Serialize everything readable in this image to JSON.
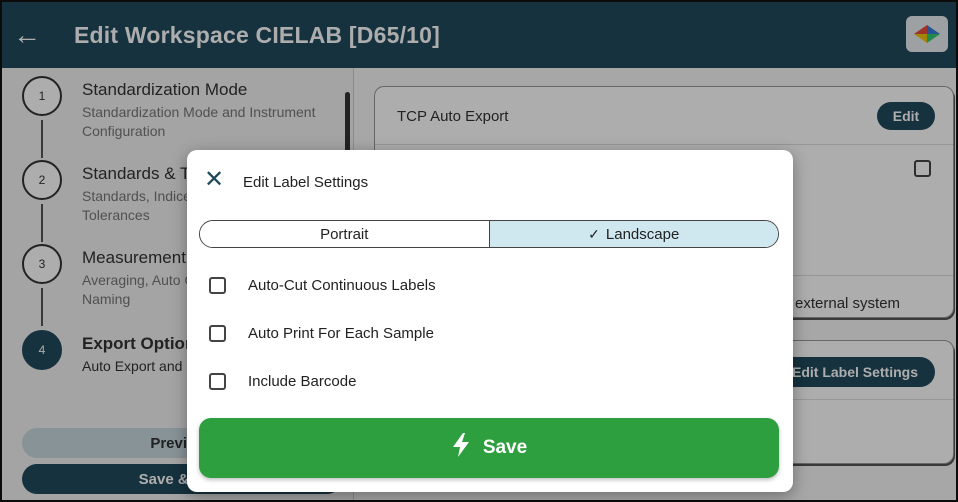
{
  "header": {
    "back_icon": "arrow-left-icon",
    "title": "Edit Workspace CIELAB [D65/10]",
    "logo_icon": "color-diamond-icon"
  },
  "steps": [
    {
      "number": "1",
      "title": "Standardization Mode",
      "desc": "Standardization Mode and Instrument Configuration"
    },
    {
      "number": "2",
      "title": "Standards & Tolerances",
      "desc": "Standards, Indices, Illuminants and Tolerances"
    },
    {
      "number": "3",
      "title": "Measurement",
      "desc": "Averaging, Auto Capture and Sample Naming"
    },
    {
      "number": "4",
      "title": "Export Options",
      "desc": "Auto Export and Labels"
    }
  ],
  "footer": {
    "previous_label": "Previous",
    "save_next_label": "Save & Next"
  },
  "right": {
    "tcp_label": "TCP Auto Export",
    "edit_label": "Edit",
    "external_text": "external system",
    "edit_label_settings": "Edit Label Settings"
  },
  "modal": {
    "close_icon": "close-icon",
    "title": "Edit Label Settings",
    "orientation": {
      "options": [
        "Portrait",
        "Landscape"
      ],
      "selected": "Landscape",
      "check": "✓"
    },
    "checkboxes": [
      {
        "label": "Auto-Cut Continuous Labels",
        "checked": false
      },
      {
        "label": "Auto Print For Each Sample",
        "checked": false
      },
      {
        "label": "Include Barcode",
        "checked": false
      }
    ],
    "save_label": "Save",
    "save_icon": "lightning-bolt-icon"
  },
  "colors": {
    "appbar": "#1f4a5c",
    "save_green": "#2e9f3f",
    "selected_segment": "#cfe8f0"
  }
}
